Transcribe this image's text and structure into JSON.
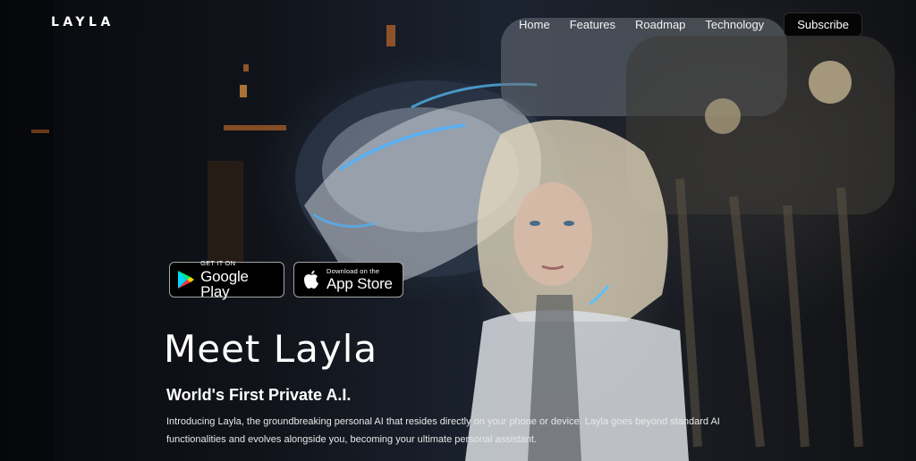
{
  "brand": {
    "logo_text": "LAYLA"
  },
  "nav": {
    "links": [
      "Home",
      "Features",
      "Roadmap",
      "Technology"
    ],
    "subscribe_label": "Subscribe"
  },
  "store_badges": {
    "google": {
      "small": "GET IT ON",
      "big": "Google Play"
    },
    "apple": {
      "small": "Download on the",
      "big": "App Store"
    }
  },
  "hero": {
    "title": "Meet Layla",
    "subtitle": "World's First Private A.I.",
    "intro": "Introducing Layla, the groundbreaking personal AI that resides directly on your phone or device. Layla goes beyond standard AI functionalities and evolves alongside you, becoming your ultimate personal assistant."
  },
  "colors": {
    "background": "#0b0d12",
    "accent_glow": "#c9742e",
    "badge_bg": "#000000",
    "text": "#ffffff"
  }
}
